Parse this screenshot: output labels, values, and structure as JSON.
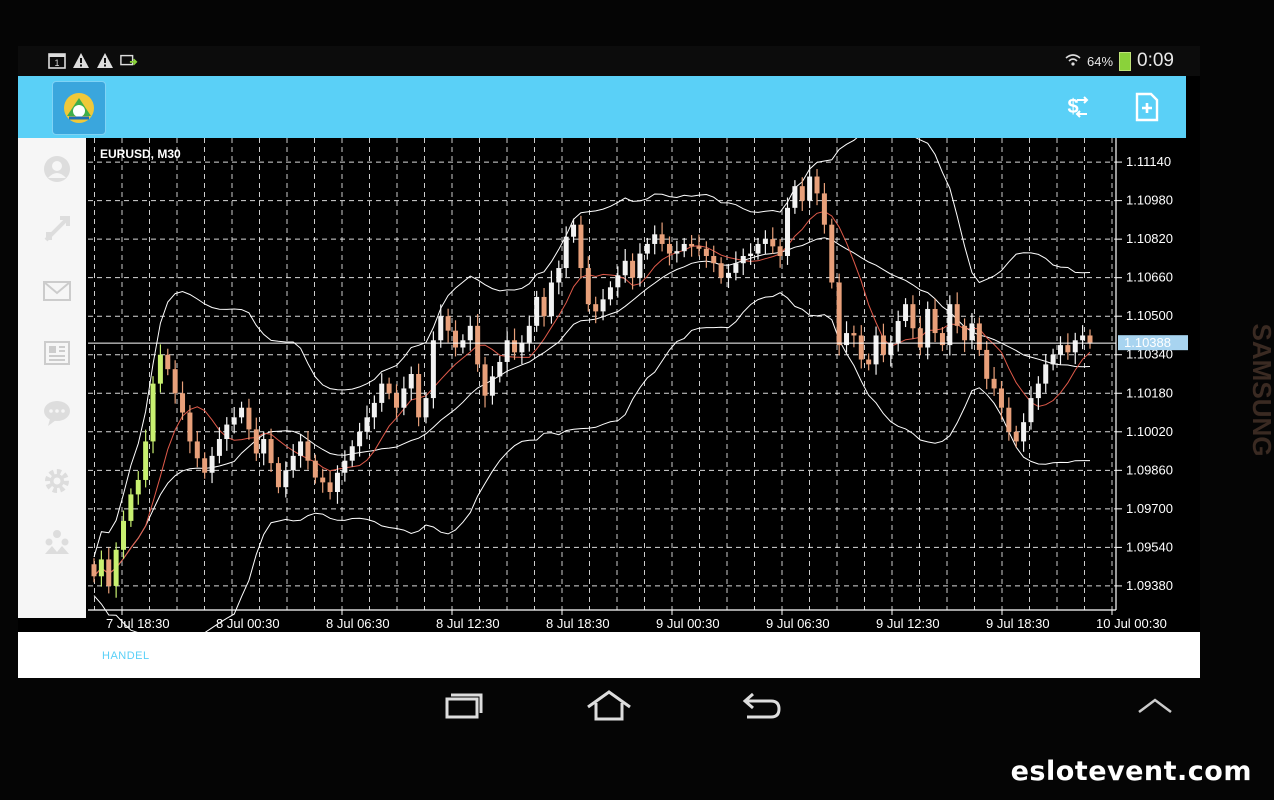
{
  "status_bar": {
    "left_icons": [
      "calendar-icon",
      "warning-icon",
      "warning-icon",
      "screen-share-icon"
    ],
    "calendar_day": "1",
    "battery_percent": "64%",
    "time": "0:09"
  },
  "app_bar": {
    "logo": "metatrader-logo",
    "actions": [
      "currency-icon",
      "new-order-icon"
    ]
  },
  "sidebar": {
    "items": [
      "quotes-icon",
      "charts-icon",
      "mail-icon",
      "news-icon",
      "chat-icon",
      "settings-icon",
      "community-icon"
    ]
  },
  "chart": {
    "symbol_label": "EURUSD, M30",
    "current_price": "1.10388",
    "y_ticks": [
      "1.11140",
      "1.10980",
      "1.10820",
      "1.10660",
      "1.10500",
      "1.10340",
      "1.10180",
      "1.10020",
      "1.09860",
      "1.09700",
      "1.09540",
      "1.09380"
    ],
    "x_ticks": [
      "7 Jul 18:30",
      "8 Jul 00:30",
      "8 Jul 06:30",
      "8 Jul 12:30",
      "8 Jul 18:30",
      "9 Jul 00:30",
      "9 Jul 06:30",
      "9 Jul 12:30",
      "9 Jul 18:30",
      "10 Jul 00:30"
    ],
    "colors": {
      "bull": "#f2f2f2",
      "bear": "#e8a07a",
      "early_bull": "#c8f070",
      "grid": "#ffffff",
      "ma_red": "#e05a4a"
    }
  },
  "chart_data": {
    "type": "candlestick",
    "title": "EURUSD, M30",
    "ylim": [
      1.0928,
      1.1124
    ],
    "categories": [
      "7 Jul 18:30",
      "8 Jul 00:30",
      "8 Jul 06:30",
      "8 Jul 12:30",
      "8 Jul 18:30",
      "9 Jul 00:30",
      "9 Jul 06:30",
      "9 Jul 12:30",
      "9 Jul 18:30",
      "10 Jul 00:30"
    ],
    "close": [
      1.0942,
      1.0949,
      1.0938,
      1.0953,
      1.0965,
      1.0976,
      1.0982,
      1.0998,
      1.1022,
      1.1034,
      1.1028,
      1.1018,
      1.101,
      1.0998,
      1.0991,
      1.0985,
      1.0992,
      1.0999,
      1.1005,
      1.1008,
      1.1012,
      1.1003,
      1.0993,
      1.0999,
      1.0989,
      1.0979,
      1.0986,
      1.0992,
      1.0998,
      1.099,
      1.0983,
      1.0981,
      1.0977,
      1.0985,
      1.099,
      1.0996,
      1.1002,
      1.1008,
      1.1014,
      1.1022,
      1.1018,
      1.1012,
      1.102,
      1.1026,
      1.1008,
      1.1016,
      1.104,
      1.105,
      1.1044,
      1.1037,
      1.104,
      1.1046,
      1.103,
      1.1017,
      1.1025,
      1.1031,
      1.104,
      1.1035,
      1.1039,
      1.1046,
      1.1058,
      1.105,
      1.1064,
      1.107,
      1.1083,
      1.1088,
      1.107,
      1.1055,
      1.1052,
      1.1057,
      1.1062,
      1.1067,
      1.1073,
      1.1066,
      1.1076,
      1.108,
      1.1084,
      1.108,
      1.1076,
      1.1077,
      1.108,
      1.1079,
      1.1078,
      1.1075,
      1.1072,
      1.1066,
      1.1068,
      1.1072,
      1.1075,
      1.1076,
      1.108,
      1.1082,
      1.1079,
      1.1075,
      1.1095,
      1.1104,
      1.1098,
      1.1108,
      1.1101,
      1.1088,
      1.1064,
      1.1038,
      1.1043,
      1.1042,
      1.1032,
      1.103,
      1.1042,
      1.1034,
      1.1039,
      1.1048,
      1.1055,
      1.1045,
      1.1037,
      1.1053,
      1.1043,
      1.1038,
      1.1055,
      1.1046,
      1.104,
      1.1047,
      1.1036,
      1.1024,
      1.102,
      1.1012,
      1.1002,
      1.0998,
      1.1006,
      1.1016,
      1.1022,
      1.103,
      1.1034,
      1.1038,
      1.1035,
      1.104,
      1.1042,
      1.1039
    ],
    "bollinger_upper_approx": [
      1.103,
      1.1,
      1.0985,
      1.1005,
      1.1028,
      1.1042,
      1.1047,
      1.1049,
      1.1046,
      1.1039,
      1.103,
      1.103,
      1.1034,
      1.1048,
      1.1059,
      1.1069,
      1.108,
      1.1084,
      1.1085,
      1.1083,
      1.1082,
      1.1079,
      1.1082,
      1.1091,
      1.1108,
      1.1113,
      1.111,
      1.11,
      1.1078,
      1.1072,
      1.107,
      1.1062
    ]
  }
}
